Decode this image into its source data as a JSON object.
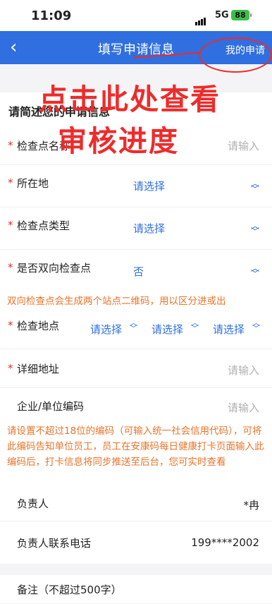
{
  "status_bar": {
    "time": "11:09",
    "network": "5G",
    "battery": "88"
  },
  "nav": {
    "back": "‹",
    "title": "填写申请信息",
    "my_application": "我的申请"
  },
  "annotation": {
    "line1": "点击此处查看",
    "line2": "审核进度"
  },
  "section": {
    "title": "请简述您的申请信息"
  },
  "fields": {
    "checkpoint_name": {
      "label": "检查点名称",
      "placeholder": "请输入"
    },
    "location": {
      "label": "所在地",
      "value": "请选择"
    },
    "checkpoint_type": {
      "label": "检查点类型",
      "value": "请选择"
    },
    "bidirectional": {
      "label": "是否双向检查点",
      "value": "否"
    },
    "bidirectional_hint": "双向检查点会生成两个站点二维码，用以区分进或出",
    "check_location": {
      "label": "检查地点",
      "selects": [
        "请选择",
        "请选择",
        "请选择"
      ]
    },
    "address": {
      "label": "详细地址",
      "placeholder": "请输入"
    },
    "company_code": {
      "label": "企业/单位编码",
      "placeholder": "请输入"
    },
    "company_code_hint": "请设置不超过18位的编码（可输入统一社会信用代码），可将此编码告知单位员工，员工在安康码每日健康打卡页面输入此编码后，打卡信息将同步推送至后台，您可实时查看",
    "person_in_charge": {
      "label": "负责人",
      "value": "*冉"
    },
    "phone": {
      "label": "负责人联系电话",
      "value": "199****2002"
    },
    "remark": {
      "label": "备注（不超过500字）"
    }
  },
  "colors": {
    "primary": "#2f6fe0",
    "required": "#e0302a",
    "hint": "#e8742a",
    "annotation": "#ee2b2b"
  }
}
